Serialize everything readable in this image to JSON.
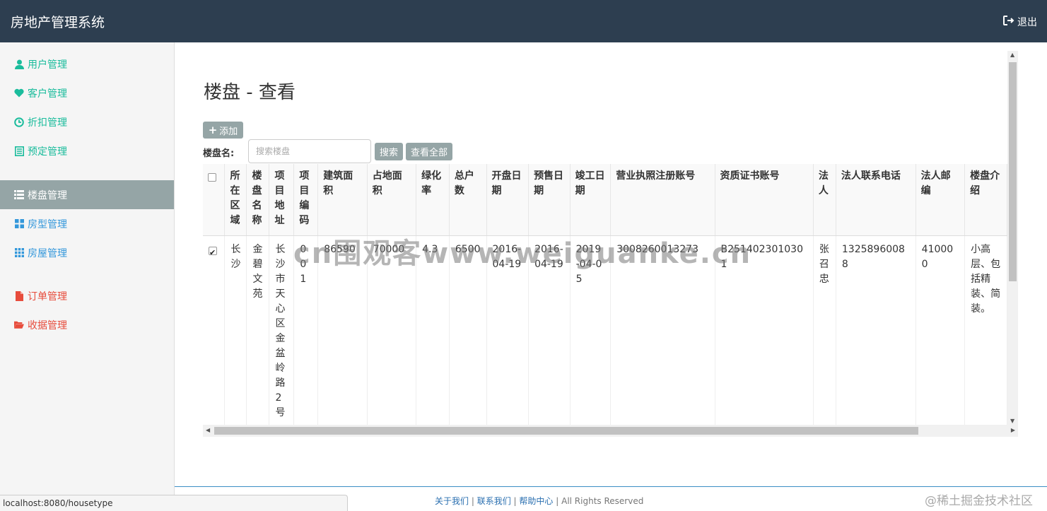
{
  "app_title": "房地产管理系统",
  "logout_label": "退出",
  "sidebar": {
    "items": [
      {
        "label": "用户管理",
        "icon": "user-icon",
        "color": "#1abc9c"
      },
      {
        "label": "客户管理",
        "icon": "heart-icon",
        "color": "#1abc9c"
      },
      {
        "label": "折扣管理",
        "icon": "clock-icon",
        "color": "#1abc9c"
      },
      {
        "label": "预定管理",
        "icon": "list-icon",
        "color": "#1abc9c"
      },
      {
        "label": "楼盘管理",
        "icon": "grid-icon",
        "color": "#ffffff"
      },
      {
        "label": "房型管理",
        "icon": "grid-icon",
        "color": "#3498db"
      },
      {
        "label": "房屋管理",
        "icon": "grid-small-icon",
        "color": "#3498db"
      },
      {
        "label": "订单管理",
        "icon": "file-icon",
        "color": "#e74c3c"
      },
      {
        "label": "收据管理",
        "icon": "folder-open-icon",
        "color": "#e74c3c"
      }
    ]
  },
  "main": {
    "page_title": "楼盘 - 查看",
    "add_button": "添加",
    "search_label": "楼盘名:",
    "search_placeholder": "搜索楼盘",
    "search_button": "搜索",
    "view_all_button": "查看全部"
  },
  "table": {
    "headers": [
      "所在区域",
      "楼盘名称",
      "项目地址",
      "项目编码",
      "建筑面积",
      "占地面积",
      "绿化率",
      "总户数",
      "开盘日期",
      "预售日期",
      "竣工日期",
      "营业执照注册账号",
      "资质证书账号",
      "法人",
      "法人联系电话",
      "法人邮编",
      "楼盘介绍"
    ],
    "rows": [
      {
        "checked": true,
        "cells": [
          "长沙",
          "金碧文苑",
          "长沙市天心区金盆岭路2号",
          "001",
          "86590",
          "70000",
          "4.3",
          "6500",
          "2016-04-19",
          "2016-04-19",
          "2019-04-05",
          "3008260013273",
          "B2514023010301",
          "张召忠",
          "13258960088",
          "410000",
          "小高层、包括精装、简装。"
        ]
      }
    ]
  },
  "watermark_text": "cn围观客www.weiguanke.cn",
  "footer": {
    "about": "关于我们",
    "contact": "联系我们",
    "help": "帮助中心",
    "rights": "| All Rights Reserved"
  },
  "juejin_watermark": "@稀土掘金技术社区",
  "status_url": "localhost:8080/housetype"
}
